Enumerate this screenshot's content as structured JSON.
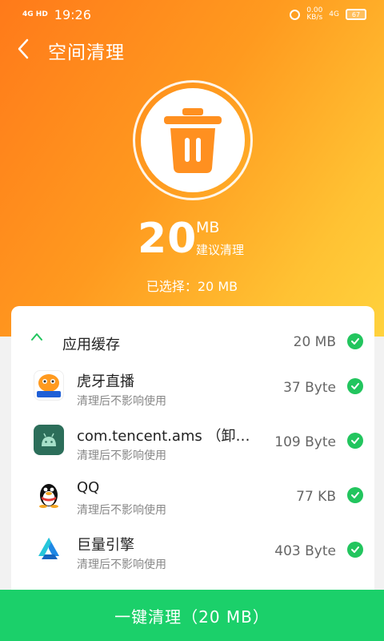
{
  "status_bar": {
    "signal": "4G HD",
    "time": "19:26",
    "net_speed": "0.00",
    "net_unit": "KB/s",
    "net_type": "4G",
    "battery": "67"
  },
  "header": {
    "title": "空间清理"
  },
  "summary": {
    "size_value": "20",
    "size_unit": "MB",
    "size_hint": "建议清理",
    "selected_text": "已选择：20 MB"
  },
  "group": {
    "label": "应用缓存",
    "size": "20 MB"
  },
  "apps": [
    {
      "name": "虎牙直播",
      "sub": "清理后不影响使用",
      "size": "37 Byte",
      "icon": "huya-icon"
    },
    {
      "name": "com.tencent.ams （卸…",
      "sub": "清理后不影响使用",
      "size": "109 Byte",
      "icon": "android-icon"
    },
    {
      "name": "QQ",
      "sub": "清理后不影响使用",
      "size": "77 KB",
      "icon": "qq-penguin-icon"
    },
    {
      "name": "巨量引擎",
      "sub": "清理后不影响使用",
      "size": "403 Byte",
      "icon": "juliang-engine-icon"
    }
  ],
  "actions": {
    "clean_button": "一键清理（20 MB）"
  },
  "colors": {
    "accent": "#ff8c1a",
    "check": "#22c55e",
    "button": "#1bd06a"
  }
}
